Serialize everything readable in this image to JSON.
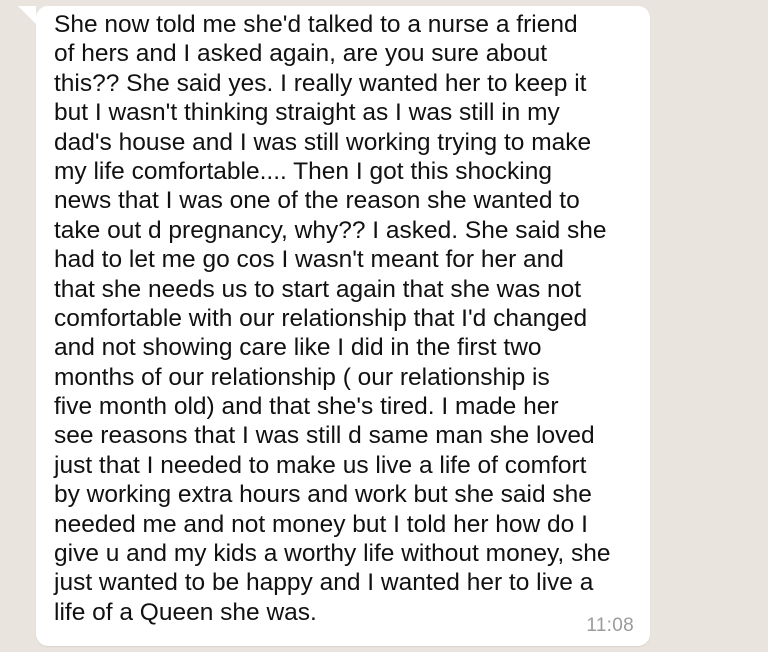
{
  "message": {
    "lines": [
      "She now told me she'd talked to a nurse a friend",
      "of hers and I asked again, are you sure about",
      "this?? She said yes. I really wanted her to keep it",
      "but I wasn't thinking straight as I was still in my",
      "dad's house and I was still working trying to make",
      "my life comfortable.... Then I got this shocking",
      "news that I was one of the reason she wanted to",
      "take out d pregnancy, why?? I asked. She said she",
      "had to let me go cos I wasn't meant for her and",
      "that she needs us to start again that she was not",
      "comfortable with our relationship that I'd changed",
      "and not showing care like I did in the first two",
      "months of our relationship ( our relationship is",
      "five month old) and that she's tired. I made her",
      "see reasons that I was still d same man she loved",
      "just that I needed to make us live a life of comfort",
      "by working extra hours and work but she said she",
      "needed me and not money but I told her how do I",
      "give u and my kids a worthy life without money, she",
      "just wanted to be happy and I wanted her to live a",
      "life of a Queen she was."
    ],
    "timestamp": "11:08"
  },
  "colors": {
    "background": "#e9e4dd",
    "bubble": "#ffffff",
    "text": "#111111",
    "timestamp": "#9b9b9b"
  }
}
